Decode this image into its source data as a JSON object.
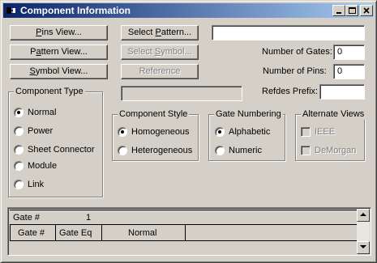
{
  "window": {
    "title": "Component Information",
    "controls": [
      "minimize",
      "maximize",
      "close"
    ]
  },
  "buttons": {
    "pins_view": {
      "pre": "",
      "ul": "P",
      "post": "ins View..."
    },
    "pattern_view": {
      "pre": "P",
      "ul": "a",
      "post": "ttern View..."
    },
    "symbol_view": {
      "pre": "",
      "ul": "S",
      "post": "ymbol View..."
    },
    "select_pattern": {
      "pre": "Select ",
      "ul": "P",
      "post": "attern..."
    },
    "select_symbol": {
      "pre": "Select ",
      "ul": "S",
      "post": "ymbol..."
    },
    "reference": {
      "pre": "",
      "ul": "",
      "post": "Reference"
    }
  },
  "fields": {
    "pattern_name": "",
    "number_of_gates_label": "Number of Gates:",
    "number_of_gates": "0",
    "number_of_pins_label": "Number of Pins:",
    "number_of_pins": "0",
    "refdes_prefix_label": "Refdes Prefix:",
    "refdes_prefix": "",
    "component_name": ""
  },
  "component_type": {
    "title": "Component Type",
    "options": [
      "Normal",
      "Power",
      "Sheet Connector",
      "Module",
      "Link"
    ],
    "selected": "Normal"
  },
  "component_style": {
    "title": "Component Style",
    "options": [
      "Homogeneous",
      "Heterogeneous"
    ],
    "selected": "Homogeneous"
  },
  "gate_numbering": {
    "title": "Gate Numbering",
    "options": [
      "Alphabetic",
      "Numeric"
    ],
    "selected": "Alphabetic"
  },
  "alternate_views": {
    "title": "Alternate Views",
    "options": [
      "IEEE",
      "DeMorgan"
    ]
  },
  "grid": {
    "gate_label": "Gate #",
    "gate_value": "1",
    "columns": [
      "Gate #",
      "Gate Eq",
      "Normal"
    ]
  }
}
